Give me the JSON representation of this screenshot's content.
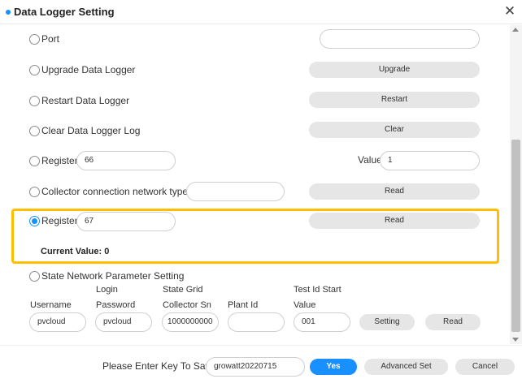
{
  "dialog": {
    "title": "Data Logger Setting",
    "accent_color": "#1890ff",
    "highlight_color": "#ffbf00"
  },
  "rows": {
    "port": {
      "label": "Port",
      "value": ""
    },
    "upgrade": {
      "label": "Upgrade Data Logger",
      "button": "Upgrade"
    },
    "restart": {
      "label": "Restart Data Logger",
      "button": "Restart"
    },
    "clear": {
      "label": "Clear Data Logger Log",
      "button": "Clear"
    },
    "register_write": {
      "label": "Register",
      "register": "66",
      "value_label": "Value",
      "value": "1"
    },
    "network_type": {
      "label": "Collector connection network type",
      "value": "",
      "button": "Read"
    },
    "register_read": {
      "label": "Register",
      "register": "67",
      "button": "Read",
      "selected": true,
      "current_value_label": "Current Value:",
      "current_value": "0"
    },
    "state_network": {
      "label": "State Network Parameter Setting",
      "headers": {
        "username": "Username",
        "login_password_1": "Login",
        "login_password_2": "Password",
        "collector_sn_1": "State Grid",
        "collector_sn_2": "Collector Sn",
        "plant_id": "Plant Id",
        "test_id_1": "Test Id Start",
        "test_id_2": "Value"
      },
      "values": {
        "username": "pvcloud",
        "password": "pvcloud",
        "collector_sn": "1000000000",
        "plant_id": "",
        "test_id": "001"
      },
      "setting_button": "Setting",
      "read_button": "Read"
    }
  },
  "footer": {
    "key_label": "Please Enter Key To Save",
    "key_value": "growatt20220715",
    "yes_button": "Yes",
    "advanced_button": "Advanced Set",
    "cancel_button": "Cancel"
  }
}
